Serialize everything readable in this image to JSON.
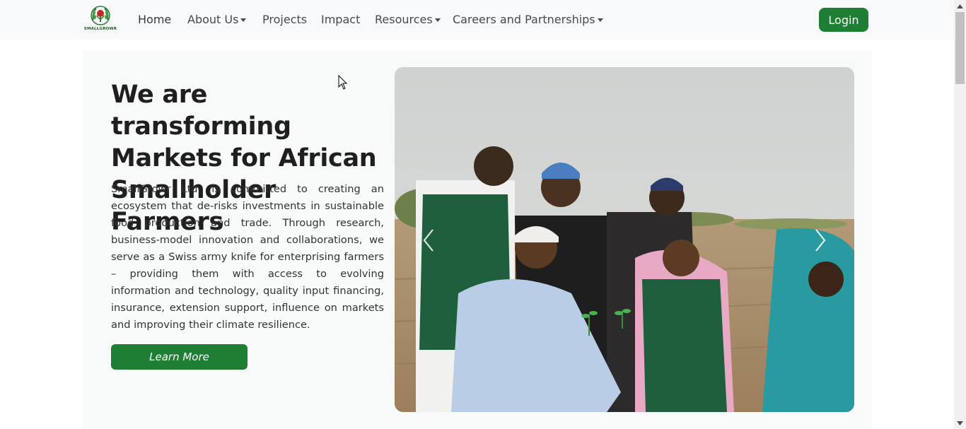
{
  "brand": {
    "name": "SMALLGROWR"
  },
  "nav": {
    "items": [
      {
        "label": "Home",
        "dropdown": false
      },
      {
        "label": "About Us",
        "dropdown": true
      },
      {
        "label": "Projects",
        "dropdown": false
      },
      {
        "label": "Impact",
        "dropdown": false
      },
      {
        "label": "Resources",
        "dropdown": true
      },
      {
        "label": "Careers and Partnerships",
        "dropdown": true
      }
    ],
    "login_label": "Login"
  },
  "hero": {
    "title": "We are transforming Markets for African Smallholder Farmers",
    "description": "SmallGrowr Ltd. is committed to creating an ecosystem that de-risks investments in sustainable food production and trade. Through research, business-model innovation and collaborations, we serve as a Swiss army knife for enterprising farmers – providing them with access to evolving information and technology, quality input financing, insurance, extension support, influence on markets and improving their climate resilience.",
    "cta_label": "Learn More"
  },
  "carousel": {
    "prev_icon": "chevron-left-icon",
    "next_icon": "chevron-right-icon"
  },
  "colors": {
    "brand_green": "#1e7e34",
    "navbar_bg": "#f8f9fa"
  }
}
